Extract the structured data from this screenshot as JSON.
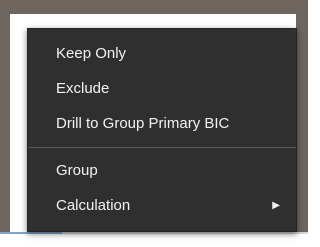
{
  "context_menu": {
    "items": [
      {
        "label": "Keep Only"
      },
      {
        "label": "Exclude"
      },
      {
        "label": "Drill to Group Primary BIC"
      },
      {
        "label": "Group"
      },
      {
        "label": "Calculation",
        "has_submenu": true,
        "submenu_icon": "chevron-right-icon"
      }
    ],
    "submenu_arrow_glyph": "▶"
  },
  "colors": {
    "menu_background": "#2f2f2f",
    "menu_text": "#f2f2f2",
    "backdrop_border": "#6e655f"
  }
}
